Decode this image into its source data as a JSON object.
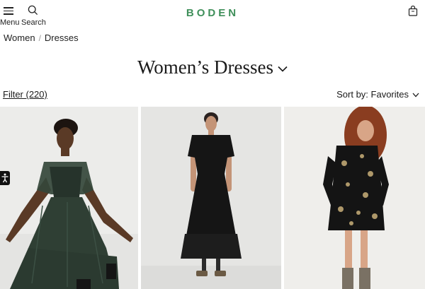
{
  "header": {
    "menu_label": "Menu",
    "search_label": "Search",
    "logo": "BODEN",
    "menu_icon": "hamburger-icon",
    "search_icon": "search-icon",
    "bag_icon": "shopping-bag-icon"
  },
  "breadcrumb": {
    "items": [
      {
        "label": "Women"
      },
      {
        "label": "Dresses"
      }
    ],
    "separator": "/"
  },
  "page": {
    "title": "Women’s Dresses",
    "title_icon": "chevron-down-icon"
  },
  "toolbar": {
    "filter_label": "Filter (220)",
    "sort_label": "Sort by: Favorites",
    "sort_icon": "chevron-down-icon"
  },
  "products": [
    {
      "name": "Green tulle midi dress",
      "colors": {
        "dress": "#2f3f34",
        "bg": "#ededeb"
      }
    },
    {
      "name": "Black tulle midi dress",
      "colors": {
        "dress": "#151515",
        "bg": "#e6e6e4"
      }
    },
    {
      "name": "Black gold print mini dress",
      "colors": {
        "dress": "#141414",
        "bg": "#f0efec"
      }
    }
  ],
  "accessibility_icon": "accessibility-icon",
  "brand_color": "#3f8f5a"
}
